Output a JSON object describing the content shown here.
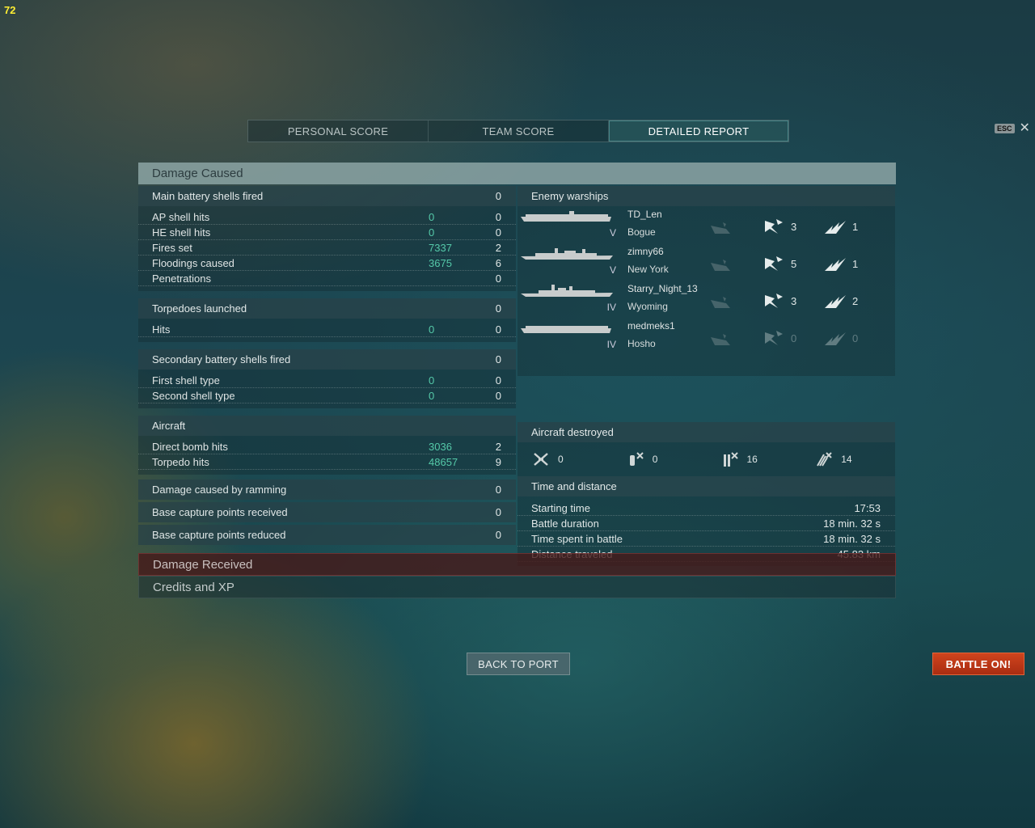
{
  "fps": "72",
  "tabs": [
    {
      "label": "PERSONAL SCORE"
    },
    {
      "label": "TEAM SCORE"
    },
    {
      "label": "DETAILED REPORT"
    }
  ],
  "esc_label": "ESC",
  "close_glyph": "✕",
  "damage_caused": {
    "title": "Damage Caused",
    "main_battery": {
      "label": "Main battery shells fired",
      "value": "0",
      "rows": [
        {
          "label": "AP shell hits",
          "damage": "0",
          "count": "0"
        },
        {
          "label": "HE shell hits",
          "damage": "0",
          "count": "0"
        },
        {
          "label": "Fires set",
          "damage": "7337",
          "count": "2"
        },
        {
          "label": "Floodings caused",
          "damage": "3675",
          "count": "6"
        },
        {
          "label": "Penetrations",
          "damage": "",
          "count": "0"
        }
      ]
    },
    "torpedoes": {
      "label": "Torpedoes launched",
      "value": "0",
      "rows": [
        {
          "label": "Hits",
          "damage": "0",
          "count": "0"
        }
      ]
    },
    "secondary": {
      "label": "Secondary battery shells fired",
      "value": "0",
      "rows": [
        {
          "label": "First shell type",
          "damage": "0",
          "count": "0"
        },
        {
          "label": "Second shell type",
          "damage": "0",
          "count": "0"
        }
      ]
    },
    "aircraft": {
      "label": "Aircraft",
      "value": "",
      "rows": [
        {
          "label": "Direct bomb hits",
          "damage": "3036",
          "count": "2"
        },
        {
          "label": "Torpedo hits",
          "damage": "48657",
          "count": "9"
        }
      ]
    },
    "ramming": {
      "label": "Damage caused by ramming",
      "value": "0"
    },
    "base_received": {
      "label": "Base capture points received",
      "value": "0"
    },
    "base_reduced": {
      "label": "Base capture points reduced",
      "value": "0"
    }
  },
  "enemy_warships": {
    "title": "Enemy warships",
    "ships": [
      {
        "player": "TD_Len",
        "vessel": "Bogue",
        "tier": "V",
        "type": "carrier",
        "fires": "3",
        "crits": "1",
        "sunk": false
      },
      {
        "player": "zimny66",
        "vessel": "New York",
        "tier": "V",
        "type": "battleship",
        "fires": "5",
        "crits": "1",
        "sunk": false
      },
      {
        "player": "Starry_Night_13",
        "vessel": "Wyoming",
        "tier": "IV",
        "type": "battleship",
        "fires": "3",
        "crits": "2",
        "sunk": false
      },
      {
        "player": "medmeks1",
        "vessel": "Hosho",
        "tier": "IV",
        "type": "carrier",
        "fires": "0",
        "crits": "0",
        "sunk": false,
        "dim": true
      }
    ]
  },
  "aircraft_destroyed": {
    "title": "Aircraft destroyed",
    "items": [
      {
        "icon": "fighter-icon",
        "value": "0"
      },
      {
        "icon": "bomber-icon",
        "value": "0"
      },
      {
        "icon": "torpedo-bomber-icon",
        "value": "16"
      },
      {
        "icon": "dive-bomber-icon",
        "value": "14"
      }
    ]
  },
  "time_distance": {
    "title": "Time and distance",
    "rows": [
      {
        "label": "Starting time",
        "value": "17:53"
      },
      {
        "label": "Battle duration",
        "value": "18 min. 32 s"
      },
      {
        "label": "Time spent in battle",
        "value": "18 min. 32 s"
      },
      {
        "label": "Distance traveled",
        "value": "45.83 km"
      }
    ]
  },
  "damage_received": {
    "title": "Damage Received"
  },
  "credits_xp": {
    "title": "Credits and XP"
  },
  "buttons": {
    "back_to_port": "BACK TO PORT",
    "battle_on": "BATTLE ON!"
  },
  "colors": {
    "accent_green": "#55c9a9",
    "battle_button": "#c23a18"
  }
}
